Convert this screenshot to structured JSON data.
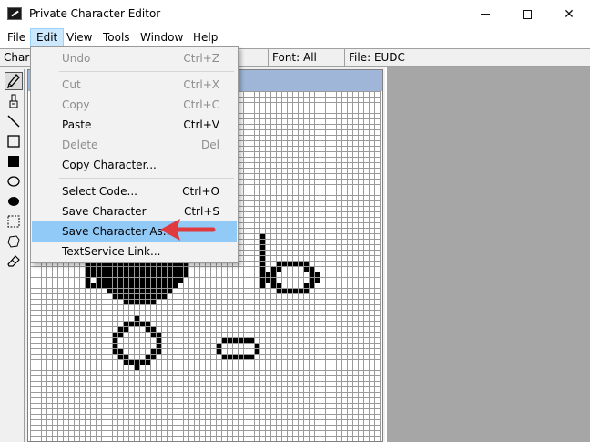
{
  "window": {
    "title": "Private Character Editor",
    "controls": {
      "minimize": "",
      "maximize": "",
      "close": "✕"
    }
  },
  "menubar": {
    "items": [
      "File",
      "Edit",
      "View",
      "Tools",
      "Window",
      "Help"
    ],
    "open": "Edit"
  },
  "status": {
    "character_label": "Chara",
    "font": "Font: All",
    "file": "File: EUDC"
  },
  "edit_menu": {
    "items": [
      {
        "label": "Undo",
        "shortcut": "Ctrl+Z",
        "enabled": false
      },
      {
        "label": "Cut",
        "shortcut": "Ctrl+X",
        "enabled": false
      },
      {
        "label": "Copy",
        "shortcut": "Ctrl+C",
        "enabled": false
      },
      {
        "label": "Paste",
        "shortcut": "Ctrl+V",
        "enabled": true
      },
      {
        "label": "Delete",
        "shortcut": "Del",
        "enabled": false
      },
      {
        "label": "Copy Character...",
        "shortcut": "",
        "enabled": true
      },
      {
        "label": "Select Code...",
        "shortcut": "Ctrl+O",
        "enabled": true
      },
      {
        "label": "Save Character",
        "shortcut": "Ctrl+S",
        "enabled": true
      },
      {
        "label": "Save Character As...",
        "shortcut": "",
        "enabled": true,
        "highlighted": true
      },
      {
        "label": "TextService Link...",
        "shortcut": "",
        "enabled": true
      }
    ]
  },
  "toolbox": {
    "tools": [
      "pencil-icon",
      "brush-icon",
      "line-icon",
      "hollow-rectangle-icon",
      "filled-rectangle-icon",
      "hollow-ellipse-icon",
      "filled-ellipse-icon",
      "rectangular-selection-icon",
      "freeform-selection-icon",
      "eraser-icon"
    ],
    "active": "pencil-icon"
  },
  "colors": {
    "menu_highlight": "#91c9f7",
    "open_menu_title": "#cce8ff",
    "editor_header": "#9fb6d8",
    "right_panel": "#a6a6a6",
    "arrow": "#e0393e"
  }
}
